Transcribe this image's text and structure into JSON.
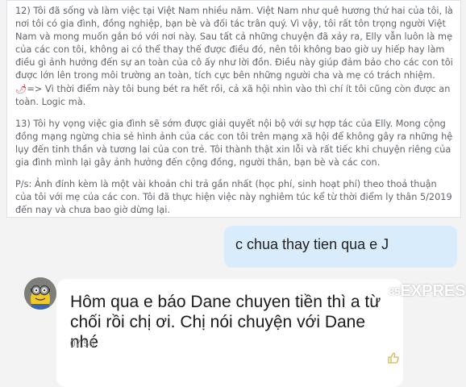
{
  "quoted_post": {
    "para12": "12) Tôi đã sống và làm việc tại Việt Nam nhiều năm. Việt Nam như quê hương thứ hai của tôi, là nơi tôi có gia đình, đồng nghiệp, bạn bè và đối tác trân quý. Vì vậy, tôi rất tôn trọng người Việt Nam và mong muốn gắn bó với nơi này. Sau tất cả những chuyện đã xảy ra, Elly vẫn luôn là mẹ của các con tôi, không ai có thể thay thế được điều đó, nên tôi không bao giờ uy hiếp hay làm điều gì ảnh hưởng đến sự an toàn của cô ấy như lời đồn. Điều này giúp đảm bảo cho các con tôi được lớn lên trong môi trường an toàn, tích cực bên những người cha và mẹ có trách nhiệm.",
    "arrow": "=>",
    "comment": "Vì thời điểm này tôi bung bét ra hết rồi, cả xã hội nhìn vào thì chí ít tôi cũng còn được an toàn. Logic mà.",
    "para13": "13) Tôi hy vọng việc gia đình sẽ sớm được giải quyết nội bộ với sự hợp tác của Elly. Mong cộng đồng mạng ngừng chia sẻ hình ảnh của các con tôi trên mạng xã hội để không gây ra những hệ lụy đến tinh thần và tương lai của con trẻ. Tôi thành thật xin lỗi và rất tiếc khi chuyện riêng của gia đình mình lại gây ảnh hưởng đến cộng đồng, người thân, bạn bè và các con.",
    "ps": "P/s: Ảnh đính kèm là một vài khoản chi trả gần nhất (học phí, sinh hoạt phí) theo thoả thuận của tôi với mẹ của các con. Tôi đã thực hiện việc này nghiêm túc kể từ thời điểm ly thân 5/2019 đến nay và chưa bao giờ dừng lại."
  },
  "sent_message": {
    "text": "c chua thay tien qua e J"
  },
  "received_message": {
    "text": "Hôm qua e báo Dane chuyen tiền thì a từ chối rồi chị ơi. Chị nói chuyện với Dane nhé",
    "time": "07:56"
  },
  "watermark": {
    "number": "35",
    "text": "EXPRESS"
  },
  "icons": {
    "avatar": "minion-avatar",
    "reaction": "thumbs-up-outline-icon",
    "comment_marker": "red-chili-icon"
  },
  "colors": {
    "sent_bubble": "#d9ecfb",
    "received_bubble": "#ffffff",
    "background": "#f3f3f3"
  }
}
